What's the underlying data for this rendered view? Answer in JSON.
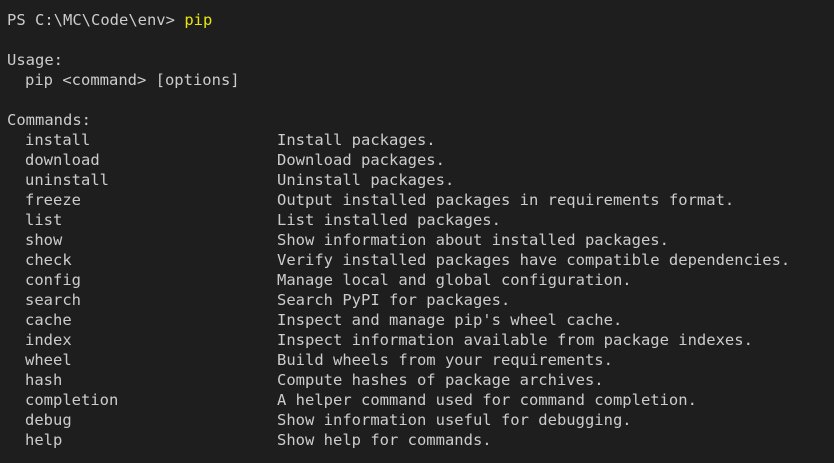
{
  "prompt": {
    "path": "PS C:\\MC\\Code\\env> ",
    "command": "pip"
  },
  "usage": {
    "heading": "Usage:",
    "syntax": "pip <command> [options]"
  },
  "commands_heading": "Commands:",
  "commands": [
    {
      "name": "install",
      "description": "Install packages."
    },
    {
      "name": "download",
      "description": "Download packages."
    },
    {
      "name": "uninstall",
      "description": "Uninstall packages."
    },
    {
      "name": "freeze",
      "description": "Output installed packages in requirements format."
    },
    {
      "name": "list",
      "description": "List installed packages."
    },
    {
      "name": "show",
      "description": "Show information about installed packages."
    },
    {
      "name": "check",
      "description": "Verify installed packages have compatible dependencies."
    },
    {
      "name": "config",
      "description": "Manage local and global configuration."
    },
    {
      "name": "search",
      "description": "Search PyPI for packages."
    },
    {
      "name": "cache",
      "description": "Inspect and manage pip's wheel cache."
    },
    {
      "name": "index",
      "description": "Inspect information available from package indexes."
    },
    {
      "name": "wheel",
      "description": "Build wheels from your requirements."
    },
    {
      "name": "hash",
      "description": "Compute hashes of package archives."
    },
    {
      "name": "completion",
      "description": "A helper command used for command completion."
    },
    {
      "name": "debug",
      "description": "Show information useful for debugging."
    },
    {
      "name": "help",
      "description": "Show help for commands."
    }
  ],
  "colors": {
    "background": "#1e1e1e",
    "text": "#cccccc",
    "command_highlight": "#e5e510"
  }
}
